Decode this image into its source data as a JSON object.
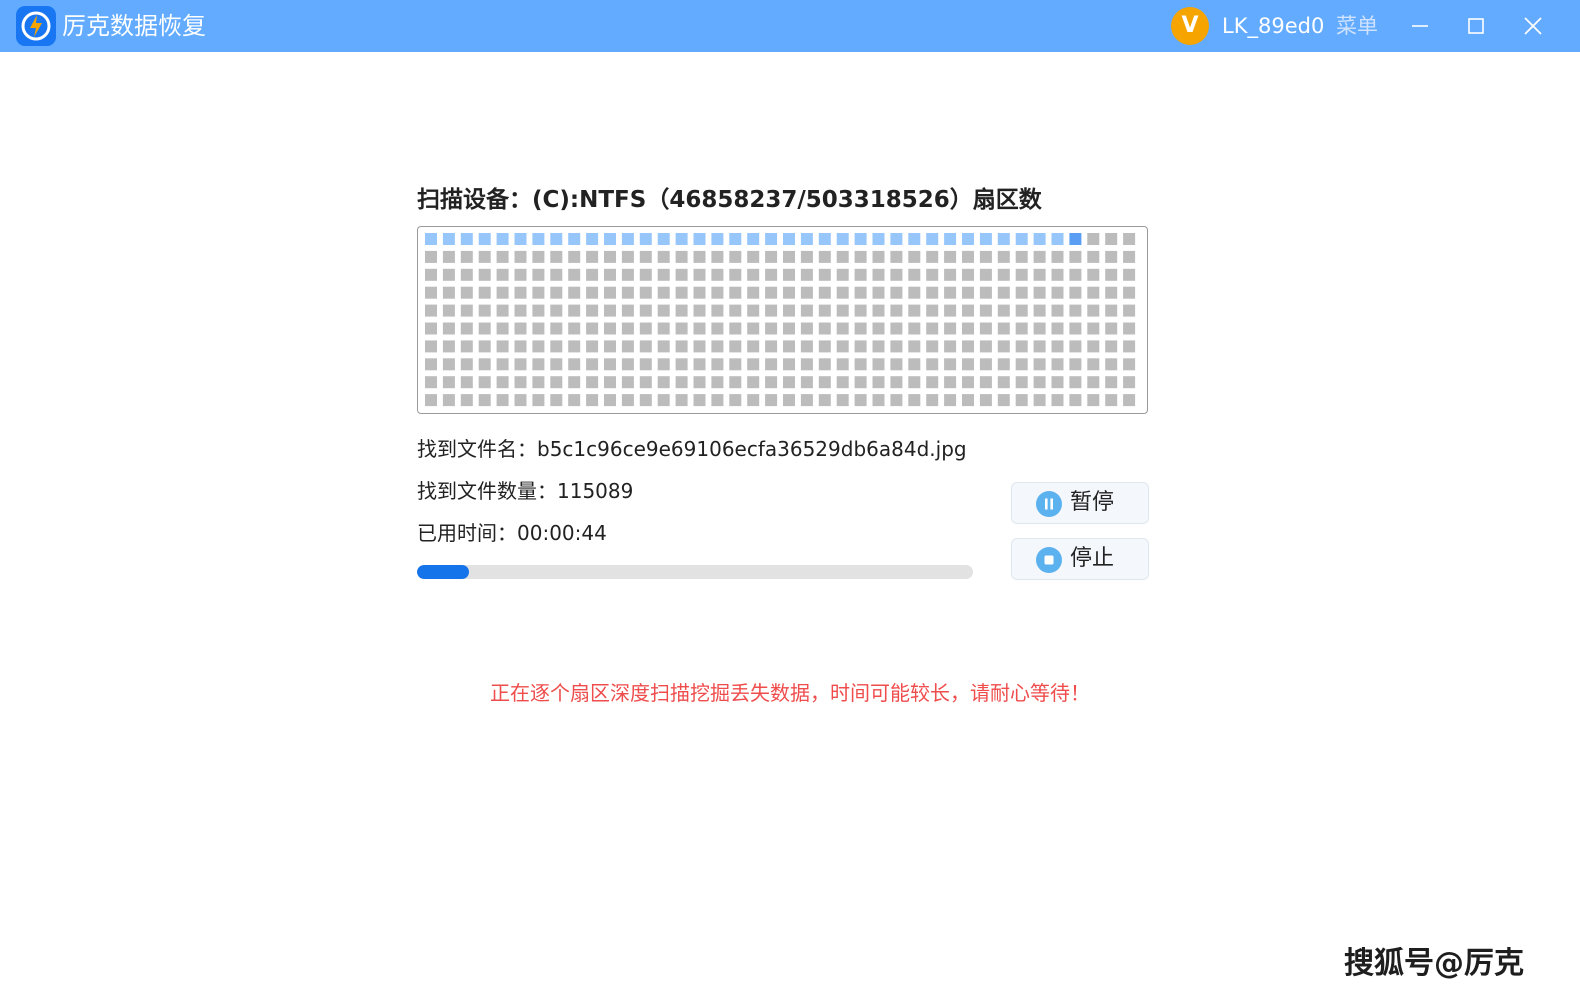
{
  "app": {
    "title": "厉克数据恢复"
  },
  "user": {
    "avatar_letter": "V",
    "name": "LK_89ed0",
    "menu_label": "菜单"
  },
  "colors": {
    "titlebar": "#62abff",
    "accent": "#1574ea",
    "sector_scanned": "#97c6fb",
    "sector_current": "#5a9ef4",
    "sector_pending": "#bcbcbc",
    "warning": "#ef4c4c",
    "avatar": "#f5a400"
  },
  "scan": {
    "title": "扫描设备：(C):NTFS（46858237/503318526）扇区数",
    "found_filename_label": "找到文件名：",
    "found_filename": "b5c1c96ce9e69106ecfa36529db6a84d.jpg",
    "found_count_label": "找到文件数量：",
    "found_count": "115089",
    "elapsed_label": "已用时间：",
    "elapsed": "00:00:44",
    "progress_fraction": 0.093,
    "sector_map": {
      "rows": 10,
      "cols": 40,
      "scanned_blocks": 36,
      "current_block": 36
    }
  },
  "controls": {
    "pause_label": "暂停",
    "stop_label": "停止"
  },
  "icons": {
    "logo": "app-logo-icon",
    "pause": "pause-icon",
    "stop": "stop-icon",
    "minimize": "minimize-icon",
    "maximize": "maximize-icon",
    "close": "close-icon"
  },
  "notice": "正在逐个扇区深度扫描挖掘丢失数据，时间可能较长，请耐心等待！",
  "watermark": "搜狐号@厉克"
}
